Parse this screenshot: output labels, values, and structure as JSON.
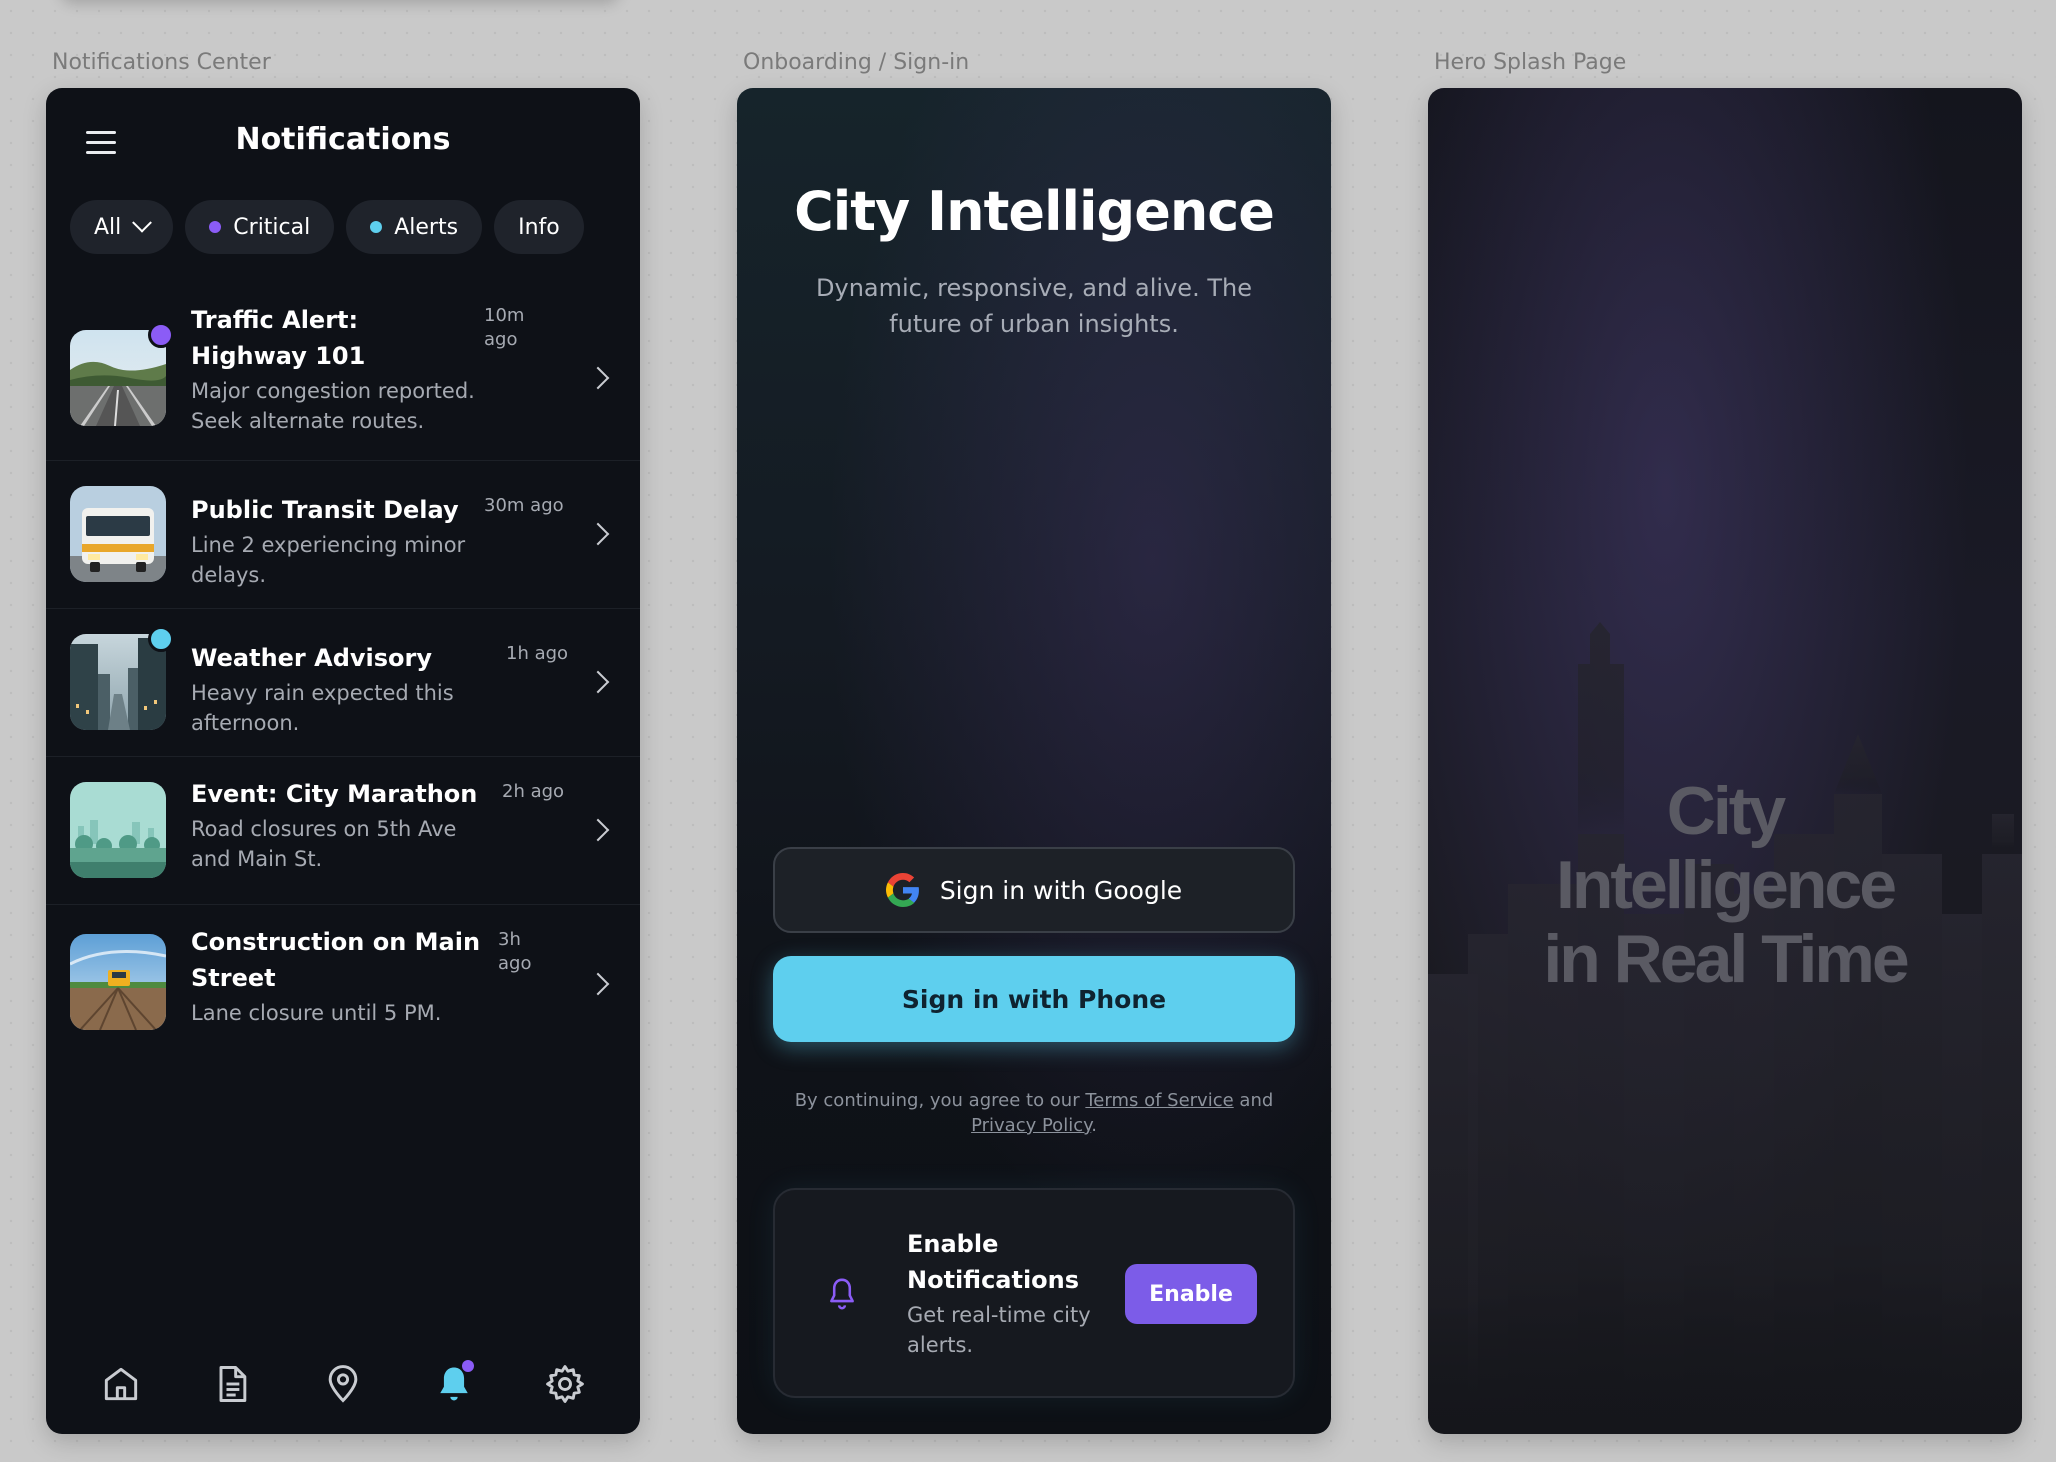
{
  "labels": {
    "frame1": "Notifications Center",
    "frame2": "Onboarding / Sign-in",
    "frame3": "Hero Splash Page"
  },
  "notifications": {
    "title": "Notifications",
    "filters": [
      {
        "label": "All",
        "has_chevron": true
      },
      {
        "label": "Critical",
        "dot_color": "#8b5cf6"
      },
      {
        "label": "Alerts",
        "dot_color": "#5ecfee"
      },
      {
        "label": "Info"
      }
    ],
    "items": [
      {
        "title": "Traffic Alert: Highway 101",
        "body": "Major congestion reported. Seek alternate routes.",
        "time": "10m ago",
        "badge_color": "#8b5cf6",
        "thumb": "highway"
      },
      {
        "title": "Public Transit Delay",
        "body": "Line 2 experiencing minor delays.",
        "time": "30m ago",
        "thumb": "bus"
      },
      {
        "title": "Weather Advisory",
        "body": "Heavy rain expected this afternoon.",
        "time": "1h ago",
        "badge_color": "#5ecfee",
        "thumb": "rain-street"
      },
      {
        "title": "Event: City Marathon",
        "body": "Road closures on 5th Ave and Main St.",
        "time": "2h ago",
        "thumb": "park"
      },
      {
        "title": "Construction on Main Street",
        "body": "Lane closure until 5 PM.",
        "time": "3h ago",
        "thumb": "construction"
      }
    ],
    "tabbar": [
      {
        "icon": "home-icon"
      },
      {
        "icon": "document-icon"
      },
      {
        "icon": "map-pin-icon"
      },
      {
        "icon": "bell-icon",
        "active": true,
        "active_color": "#5ecfee"
      },
      {
        "icon": "gear-icon"
      }
    ]
  },
  "onboarding": {
    "title": "City Intelligence",
    "subtitle": "Dynamic, responsive, and alive. The future of urban insights.",
    "google_button": "Sign in with Google",
    "phone_button": "Sign in with Phone",
    "legal_prefix": "By continuing, you agree to our",
    "terms_link": "Terms of Service",
    "legal_and": "and",
    "privacy_link": "Privacy Policy",
    "legal_suffix": ".",
    "enable_card": {
      "title": "Enable Notifications",
      "subtitle": "Get real-time city alerts.",
      "button": "Enable"
    }
  },
  "hero": {
    "line1": "City",
    "line2": "Intelligence",
    "line3": "in Real Time"
  },
  "colors": {
    "accent_purple": "#8b5cf6",
    "accent_cyan": "#5ecfee",
    "enable_button": "#7c5ce8"
  }
}
